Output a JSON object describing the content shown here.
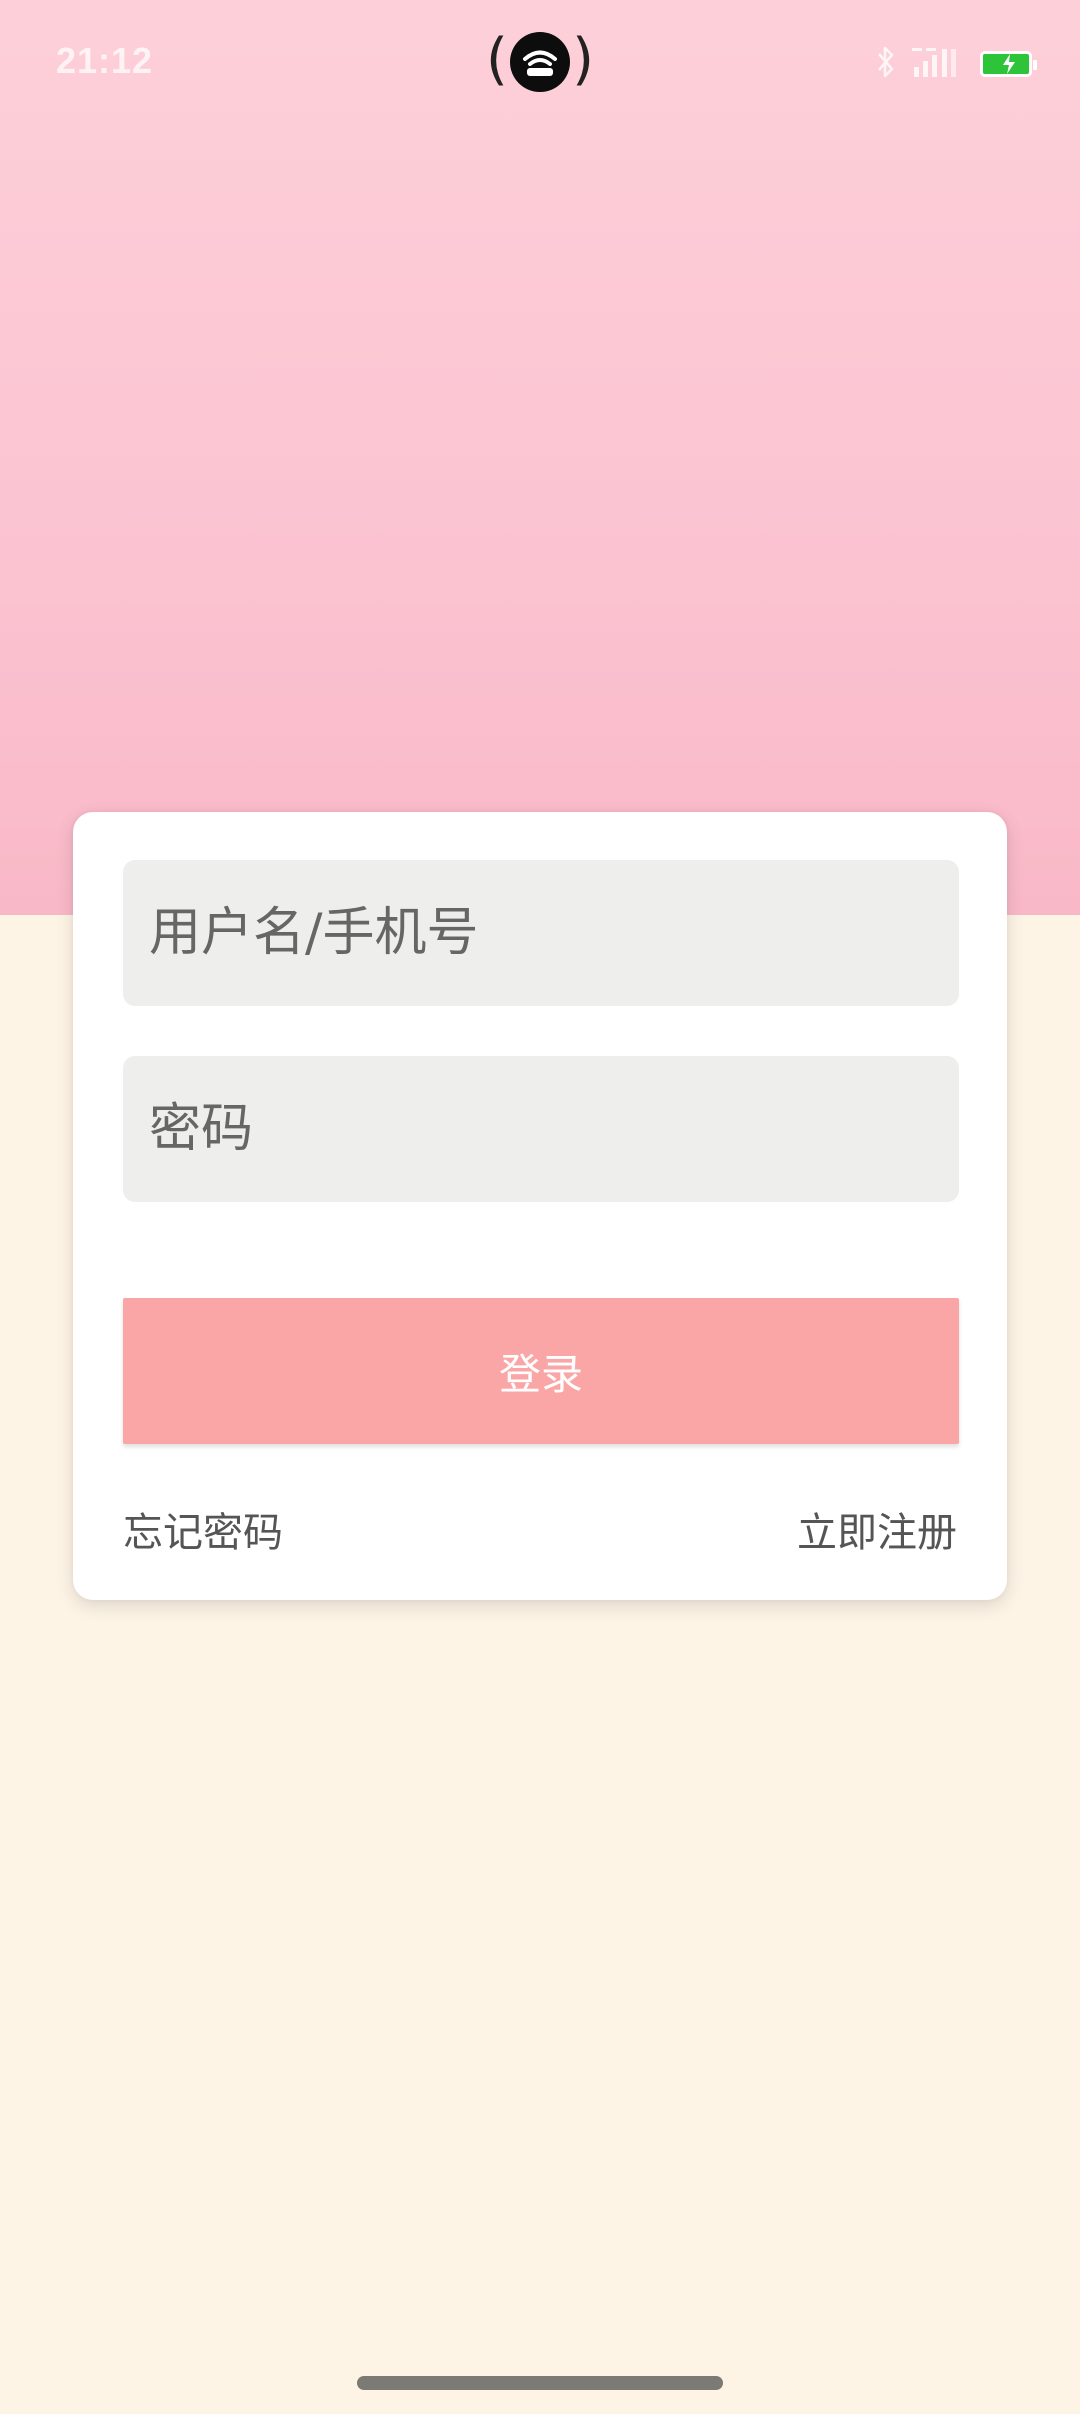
{
  "status_bar": {
    "time": "21:12",
    "icons": [
      "hotspot-icon",
      "bluetooth-icon",
      "signal-icon",
      "battery-charging-icon"
    ]
  },
  "colors": {
    "top_background": "#fbc3d1",
    "bottom_background": "#fdf4e6",
    "input_background": "#eeefed",
    "login_button": "#fba6a6",
    "battery": "#2ec43a"
  },
  "login_form": {
    "username_placeholder": "用户名/手机号",
    "password_placeholder": "密码",
    "login_label": "登录",
    "forgot_password_label": "忘记密码",
    "register_label": "立即注册"
  }
}
